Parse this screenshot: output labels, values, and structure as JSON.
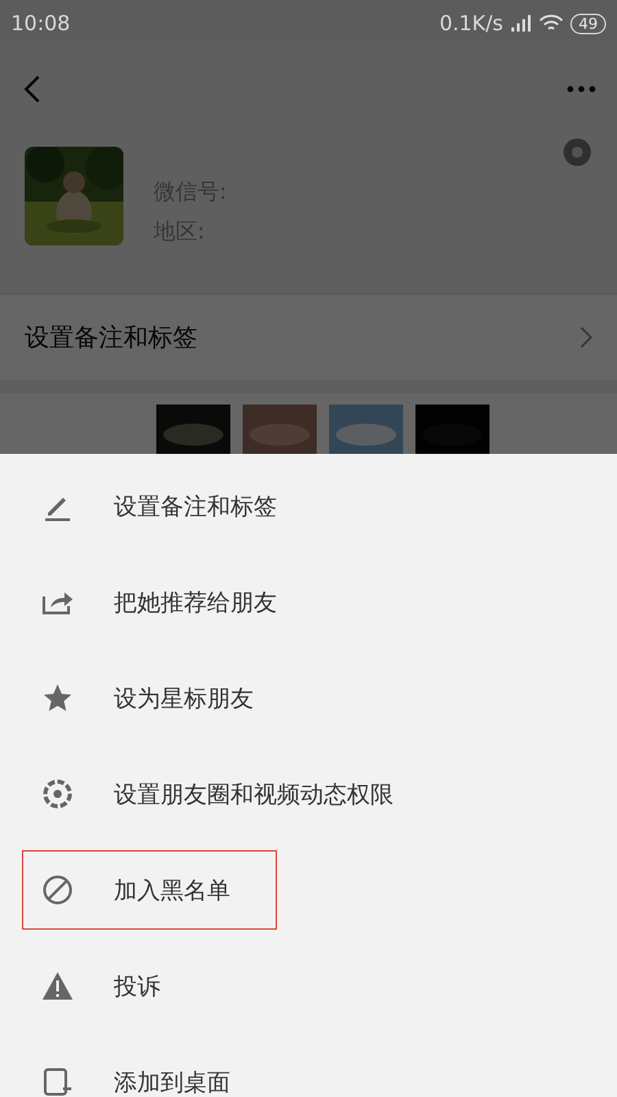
{
  "status_bar": {
    "time": "10:08",
    "speed": "0.1K/s",
    "battery": "49"
  },
  "profile": {
    "wechat_id_label": "微信号:",
    "region_label": "地区:"
  },
  "remark_row": {
    "label": "设置备注和标签"
  },
  "menu": [
    {
      "kind": "edit",
      "label": "设置备注和标签",
      "highlighted": false
    },
    {
      "kind": "share",
      "label": "把她推荐给朋友",
      "highlighted": false
    },
    {
      "kind": "star",
      "label": "设为星标朋友",
      "highlighted": false
    },
    {
      "kind": "aperture",
      "label": "设置朋友圈和视频动态权限",
      "highlighted": false
    },
    {
      "kind": "block",
      "label": "加入黑名单",
      "highlighted": true
    },
    {
      "kind": "warning",
      "label": "投诉",
      "highlighted": false
    },
    {
      "kind": "desktop",
      "label": "添加到桌面",
      "highlighted": false
    }
  ]
}
